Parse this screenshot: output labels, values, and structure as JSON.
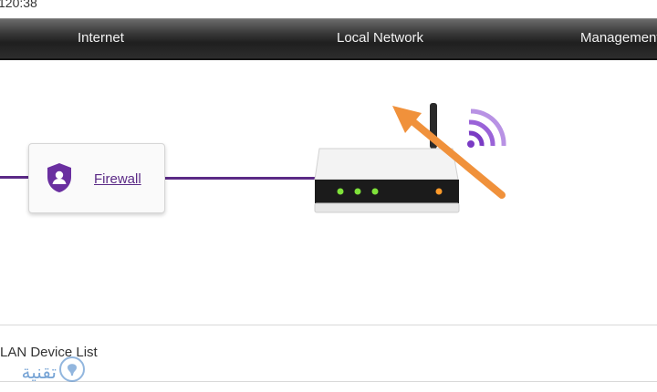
{
  "status": {
    "time": "120:38"
  },
  "nav": {
    "items": [
      {
        "label": "Internet"
      },
      {
        "label": "Local Network"
      },
      {
        "label": "Management"
      }
    ]
  },
  "diagram": {
    "firewall_label": "Firewall"
  },
  "sections": {
    "lan_device_list": "LAN Device List"
  },
  "watermark": {
    "text": "تقنية"
  },
  "colors": {
    "accent": "#5b2a86",
    "wifi": "#8a4fd0",
    "annotation_arrow": "#f0913b",
    "led_green": "#7fe23a",
    "led_orange": "#ff9a2a"
  },
  "icons": {
    "firewall": "shield-user-icon",
    "router": "router-icon",
    "wifi": "wifi-icon",
    "annotation": "arrow-icon"
  }
}
